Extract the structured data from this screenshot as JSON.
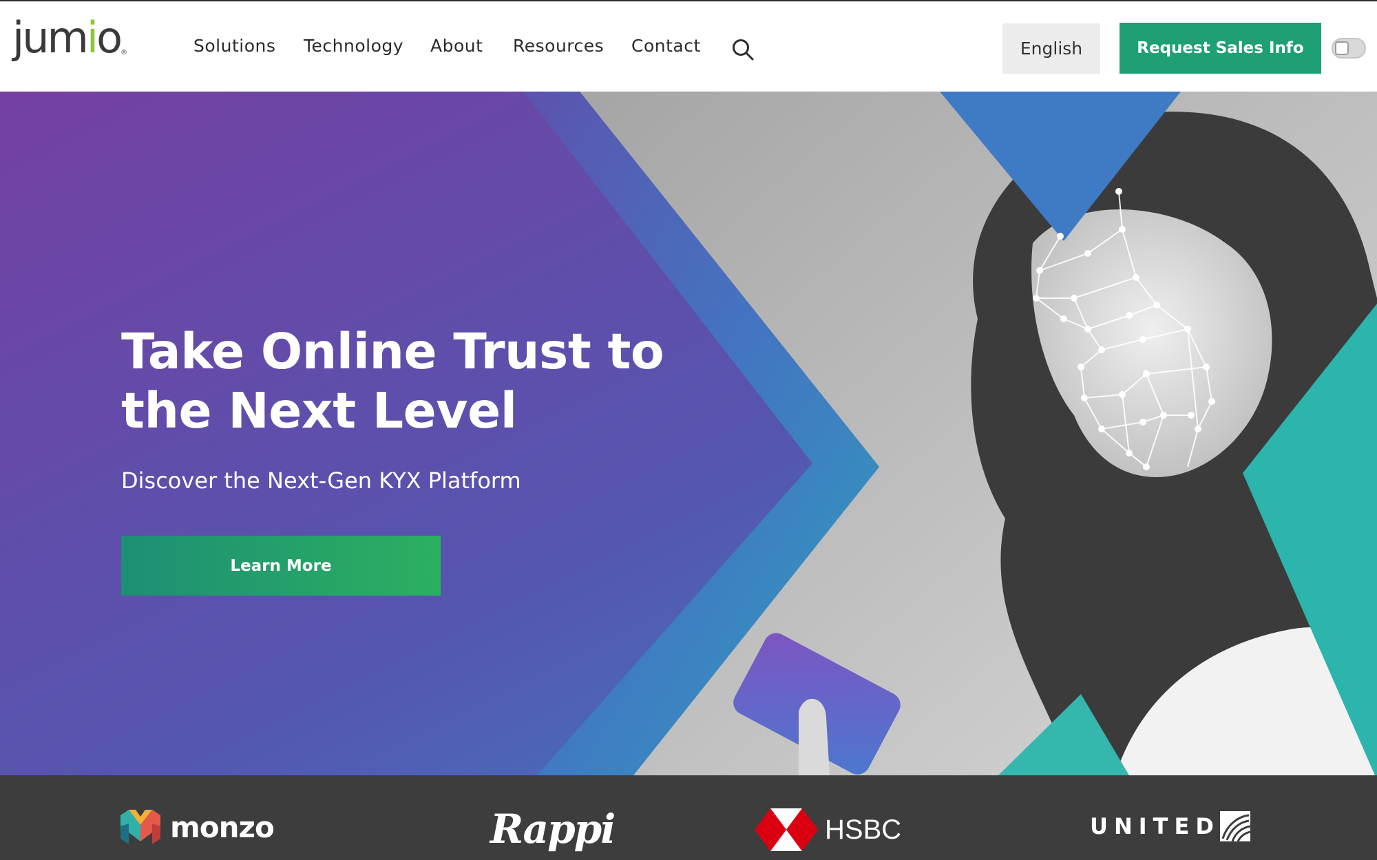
{
  "header": {
    "logo_text": "jumio",
    "nav": [
      {
        "label": "Solutions"
      },
      {
        "label": "Technology"
      },
      {
        "label": "About"
      },
      {
        "label": "Resources"
      },
      {
        "label": "Contact"
      }
    ],
    "search_icon": "search-icon",
    "language_label": "English",
    "cta_label": "Request Sales Info",
    "toggle_icon": "accessibility-toggle-icon"
  },
  "hero": {
    "title": "Take Online Trust to the Next Level",
    "subtitle": "Discover the Next-Gen KYX Platform",
    "button_label": "Learn More"
  },
  "partners": [
    {
      "name": "monzo"
    },
    {
      "name": "Rappi"
    },
    {
      "name": "HSBC"
    },
    {
      "name": "UNITED"
    }
  ],
  "colors": {
    "brand_green": "#1f9f74",
    "logo_accent": "#8cc63f",
    "hero_purple": "#7440a2",
    "hero_blue": "#3f7bc5",
    "hero_teal": "#2bb5ad",
    "partner_bar": "#3d3d3d"
  }
}
